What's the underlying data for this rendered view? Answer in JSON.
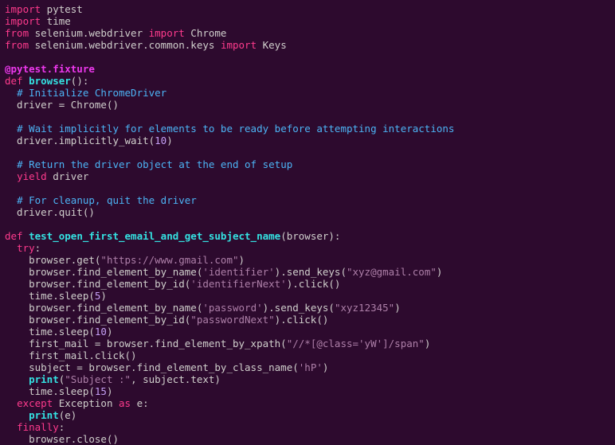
{
  "code": {
    "l01a": "import",
    "l01b": " pytest",
    "l02a": "import",
    "l02b": " time",
    "l03a": "from",
    "l03b": " selenium.webdriver ",
    "l03c": "import",
    "l03d": " Chrome",
    "l04a": "from",
    "l04b": " selenium.webdriver.common.keys ",
    "l04c": "import",
    "l04d": " Keys",
    "blank1": "",
    "l05a": "@pytest.fixture",
    "l06a": "def",
    "l06b": " ",
    "l06c": "browser",
    "l06d": "():",
    "l07a": "  ",
    "l07b": "# Initialize ChromeDriver",
    "l08a": "  driver = Chrome()",
    "blank2": "",
    "l09a": "  ",
    "l09b": "# Wait implicitly for elements to be ready before attempting interactions",
    "l10a": "  driver.implicitly_wait(",
    "l10b": "10",
    "l10c": ")",
    "blank3": "",
    "l11a": "  ",
    "l11b": "# Return the driver object at the end of setup",
    "l12a": "  ",
    "l12b": "yield",
    "l12c": " driver",
    "blank4": "",
    "l13a": "  ",
    "l13b": "# For cleanup, quit the driver",
    "l14a": "  driver.quit()",
    "blank5": "",
    "l15a": "def",
    "l15b": " ",
    "l15c": "test_open_first_email_and_get_subject_name",
    "l15d": "(browser):",
    "l16a": "  ",
    "l16b": "try",
    "l16c": ":",
    "l17a": "    browser.get(",
    "l17b": "\"https://www.gmail.com\"",
    "l17c": ")",
    "l18a": "    browser.find_element_by_name(",
    "l18b": "'identifier'",
    "l18c": ").send_keys(",
    "l18d": "\"xyz@gmail.com\"",
    "l18e": ")",
    "l19a": "    browser.find_element_by_id(",
    "l19b": "'identifierNext'",
    "l19c": ").click()",
    "l20a": "    time.sleep(",
    "l20b": "5",
    "l20c": ")",
    "l21a": "    browser.find_element_by_name(",
    "l21b": "'password'",
    "l21c": ").send_keys(",
    "l21d": "\"xyz12345\"",
    "l21e": ")",
    "l22a": "    browser.find_element_by_id(",
    "l22b": "\"passwordNext\"",
    "l22c": ").click()",
    "l23a": "    time.sleep(",
    "l23b": "10",
    "l23c": ")",
    "l24a": "    first_mail = browser.find_element_by_xpath(",
    "l24b": "\"//*[@class='yW']/span\"",
    "l24c": ")",
    "l25a": "    first_mail.click()",
    "l26a": "    subject = browser.find_element_by_class_name(",
    "l26b": "'hP'",
    "l26c": ")",
    "l27a": "    ",
    "l27b": "print",
    "l27c": "(",
    "l27d": "\"Subject :\"",
    "l27e": ", subject.text)",
    "l28a": "    time.sleep(",
    "l28b": "15",
    "l28c": ")",
    "l29a": "  ",
    "l29b": "except",
    "l29c": " Exception ",
    "l29d": "as",
    "l29e": " e:",
    "l30a": "    ",
    "l30b": "print",
    "l30c": "(e)",
    "l31a": "  ",
    "l31b": "finally",
    "l31c": ":",
    "l32a": "    browser.close()"
  }
}
